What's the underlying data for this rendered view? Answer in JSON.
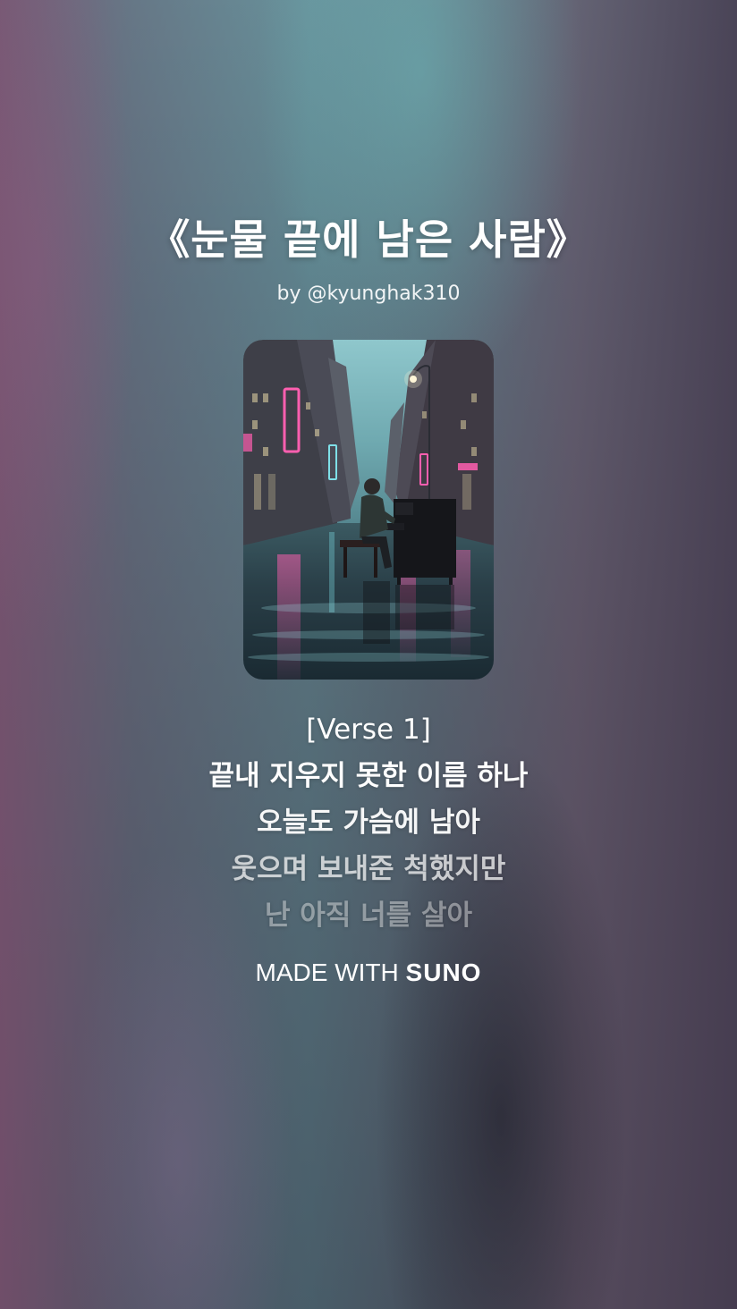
{
  "song": {
    "title": "《눈물 끝에 남은 사람》",
    "artist": "by @kyunghak310"
  },
  "lyrics": [
    "[Verse 1]",
    "끝내 지우지 못한 이름 하나",
    "오늘도 가슴에 남아",
    "웃으며 보내준 척했지만",
    "난 아직 너를 살아"
  ],
  "branding": {
    "prefix": "MADE WITH",
    "name": "SUNO"
  },
  "colors": {
    "neon_pink": "#ff5fb0",
    "neon_cyan": "#7fe0e8",
    "sky": "#8fc7cc"
  }
}
